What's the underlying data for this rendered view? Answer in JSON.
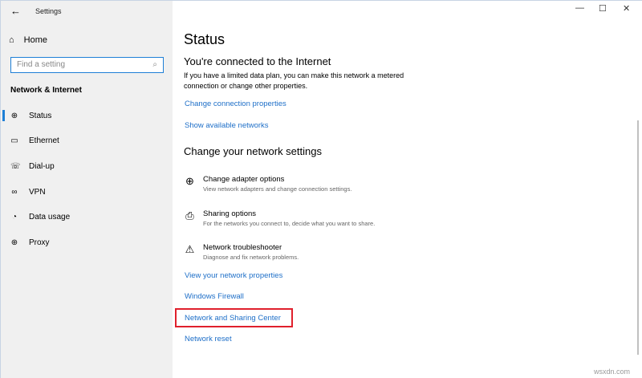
{
  "window": {
    "title": "Settings",
    "back": "←",
    "minimize": "—",
    "maximize": "☐",
    "close": "✕"
  },
  "sidebar": {
    "home": "Home",
    "search_placeholder": "Find a setting",
    "section": "Network & Internet",
    "items": [
      {
        "label": "Status",
        "icon": "⊕"
      },
      {
        "label": "Ethernet",
        "icon": "▭"
      },
      {
        "label": "Dial-up",
        "icon": "☏"
      },
      {
        "label": "VPN",
        "icon": "∞"
      },
      {
        "label": "Data usage",
        "icon": "◔"
      },
      {
        "label": "Proxy",
        "icon": "⊕"
      }
    ]
  },
  "main": {
    "title": "Status",
    "connected": "You're connected to the Internet",
    "desc": "If you have a limited data plan, you can make this network a metered connection or change other properties.",
    "link1": "Change connection properties",
    "link2": "Show available networks",
    "heading2": "Change your network settings",
    "options": [
      {
        "title": "Change adapter options",
        "desc": "View network adapters and change connection settings."
      },
      {
        "title": "Sharing options",
        "desc": "For the networks you connect to, decide what you want to share."
      },
      {
        "title": "Network troubleshooter",
        "desc": "Diagnose and fix network problems."
      }
    ],
    "links": [
      "View your network properties",
      "Windows Firewall",
      "Network and Sharing Center",
      "Network reset"
    ]
  },
  "watermark": "wsxdn.com"
}
